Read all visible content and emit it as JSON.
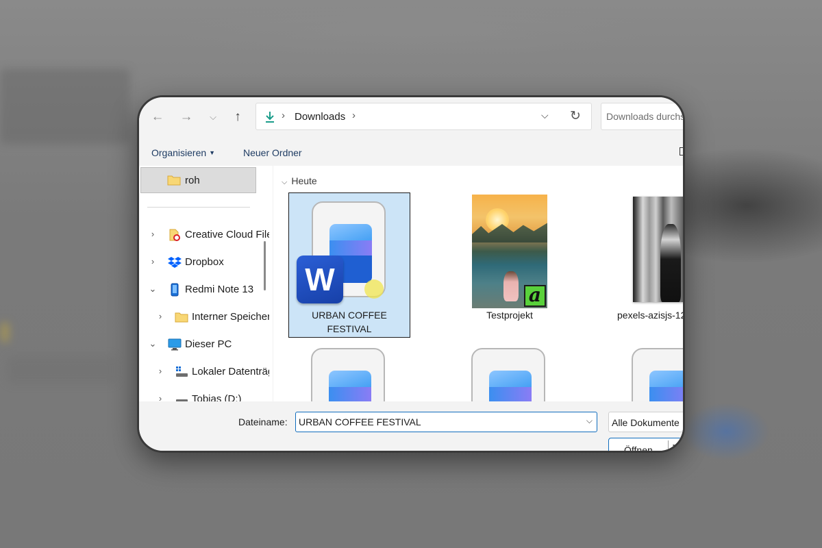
{
  "address_bar": {
    "location": "Downloads",
    "search_placeholder": "Downloads durchsuchen"
  },
  "command_bar": {
    "organize_label": "Organisieren",
    "new_folder_label": "Neuer Ordner"
  },
  "nav_pane": {
    "quick_access_item": "roh",
    "items": [
      {
        "label": "Creative Cloud Files",
        "expanded": false,
        "icon": "creative-cloud-icon"
      },
      {
        "label": "Dropbox",
        "expanded": false,
        "icon": "dropbox-icon"
      },
      {
        "label": "Redmi Note 13",
        "expanded": true,
        "icon": "phone-icon"
      },
      {
        "label": "Interner Speicher",
        "expanded": false,
        "icon": "folder-icon"
      },
      {
        "label": "Dieser PC",
        "expanded": true,
        "icon": "computer-icon"
      },
      {
        "label": "Lokaler Datenträger",
        "expanded": false,
        "icon": "drive-icon"
      },
      {
        "label": "Tobias (D:)",
        "expanded": false,
        "icon": "drive-icon"
      }
    ]
  },
  "content": {
    "group_label": "Heute",
    "files": [
      {
        "name": "URBAN COFFEE FESTIVAL",
        "type": "word-document",
        "selected": true
      },
      {
        "name": "Testprojekt",
        "type": "image-affinity",
        "selected": false
      },
      {
        "name": "pexels-azisjs-12",
        "type": "image-photo",
        "selected": false
      },
      {
        "name": "",
        "type": "document",
        "selected": false
      },
      {
        "name": "",
        "type": "document",
        "selected": false
      },
      {
        "name": "",
        "type": "document",
        "selected": false
      }
    ]
  },
  "bottom_bar": {
    "filename_label": "Dateiname:",
    "filename_value": "URBAN COFFEE FESTIVAL",
    "filetype_value": "Alle Dokumente",
    "open_label": "Öffnen"
  },
  "colors": {
    "accent": "#0f6cbd",
    "selection": "#cce4f7",
    "toolbar_bg": "#f3f3f3"
  }
}
